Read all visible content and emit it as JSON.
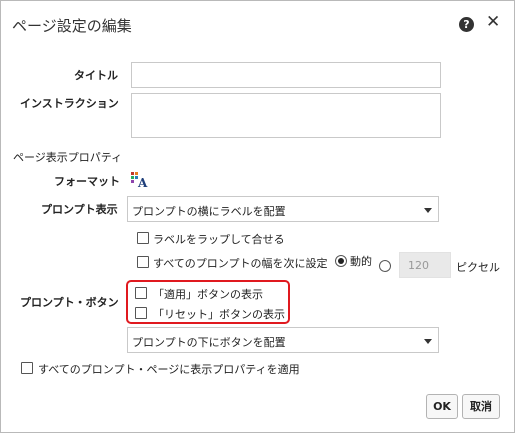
{
  "dialog": {
    "title": "ページ設定の編集",
    "help_glyph": "?",
    "close_glyph": "✕"
  },
  "form": {
    "title_label": "タイトル",
    "title_value": "",
    "instruction_label": "インストラクション",
    "instruction_value": "",
    "section_heading": "ページ表示プロパティ",
    "format_label": "フォーマット",
    "prompt_display_label": "プロンプト表示",
    "prompt_display_value": "プロンプトの横にラベルを配置",
    "wrap_label_checkbox": "ラベルをラップして合せる",
    "wrap_label_checked": false,
    "width_checkbox": "すべてのプロンプトの幅を次に設定",
    "width_checked": false,
    "dynamic_radio": "動的",
    "dynamic_selected": true,
    "fixed_selected": false,
    "width_value": "120",
    "pixel_unit": "ピクセル",
    "prompt_buttons_label": "プロンプト・ボタン",
    "show_apply_checkbox": "「適用」ボタンの表示",
    "show_apply_checked": false,
    "show_reset_checkbox": "「リセット」ボタンの表示",
    "show_reset_checked": false,
    "button_position_value": "プロンプトの下にボタンを配置",
    "apply_all_checkbox": "すべてのプロンプト・ページに表示プロパティを適用",
    "apply_all_checked": false
  },
  "footer": {
    "ok_label": "OK",
    "cancel_label": "取消"
  },
  "colors": {
    "highlight_border": "#e0191f",
    "dialog_border": "#b9b9b9",
    "input_border": "#c9c9c9",
    "disabled_input_bg": "#e9e9e9"
  },
  "icons": {
    "help": "help-icon",
    "close": "close-icon",
    "format": "format-icon",
    "select_arrow": "chevron-down-icon"
  }
}
